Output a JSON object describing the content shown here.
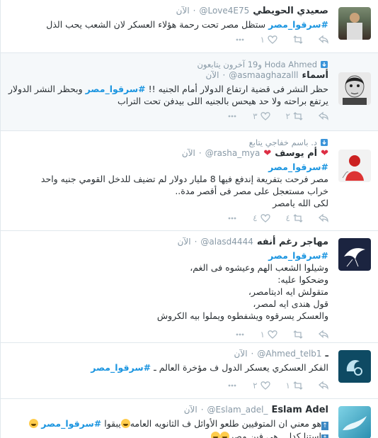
{
  "tweets": [
    {
      "name": "صعيدي الحويطي",
      "handle": "@Love4E75",
      "time": "الآن",
      "hashtag": "#سرقوا_مصر",
      "text": "ستظل مصر تحت رحمة هؤلاء العسكر لان الشعب يحب الذل",
      "actions": {
        "reply": "",
        "retweet": "",
        "like": "١",
        "more": ""
      }
    },
    {
      "context": "Hoda Ahmed و19 آخرون يتابعون",
      "name": "أسماء",
      "handle": "@asmaaghazalll",
      "time": "الآن",
      "line1_prefix": "حظر النشر فى قضية ارتفاع الدولار أمام الجنيه !!",
      "hashtag": "#سرقوا_مصر",
      "line1_suffix": "وبحظر النشر الدولار",
      "line2": "يرتفع براحته ولا حد هيحس بالجنيه اللى بيدفن تحت التراب",
      "actions": {
        "reply": "",
        "retweet": "٢",
        "like": "٣",
        "more": ""
      }
    },
    {
      "context": "د. باسم خفاجي يتابع",
      "name": "أم يوسف",
      "heart": "❤",
      "handle": "@rasha_mya",
      "time": "الآن",
      "hashtag": "#سرقوا_مصر",
      "line1": "مصر فرحت بتفريعة إندفع فيها 8 مليار دولار لم تضيف للدخل القومي جنيه واحد",
      "line2": "خراب مستعجل على مصر فى أقصر مدة..",
      "line3": "لكى الله يامصر",
      "actions": {
        "reply": "",
        "retweet": "٤",
        "like": "٤",
        "more": ""
      }
    },
    {
      "name": "مهاجر رغم أنفه",
      "handle": "@alasd4444",
      "time": "الآن",
      "hashtag": "#سرقوا_مصر",
      "lines": [
        "وشيلوا الشعب الهم وعيشوه فى الغم،",
        "وضحكوا عليه:",
        "متقولش ايه اديتامصر،",
        "قول هندى ايه لمصر،",
        "والعسكر يسرقوه ويشفطوه ويملوا بيه الكروش"
      ],
      "actions": {
        "reply": "",
        "retweet": "",
        "like": "١",
        "more": ""
      }
    },
    {
      "name": "ـ",
      "handle": "@Ahmed_telb1",
      "time": "الآن",
      "text": "الفكر العسكري  يعسكر الدول ف مؤخرة العالم ـ",
      "hashtag": "#سرقوا_مصر",
      "actions": {
        "reply": "",
        "retweet": "١",
        "like": "٢",
        "more": ""
      }
    },
    {
      "name": "Eslam Adel",
      "handle": "@Eslam_adel_",
      "time": "الآن",
      "line1_a": "هو معني ان المتوفيين طلعو الأوائل ف الثانويه العامه",
      "line1_b": "يبقوا",
      "hashtag": "#سرقوا_مصر",
      "line2": "استنا كدا,,, هي فين مصر"
    }
  ]
}
